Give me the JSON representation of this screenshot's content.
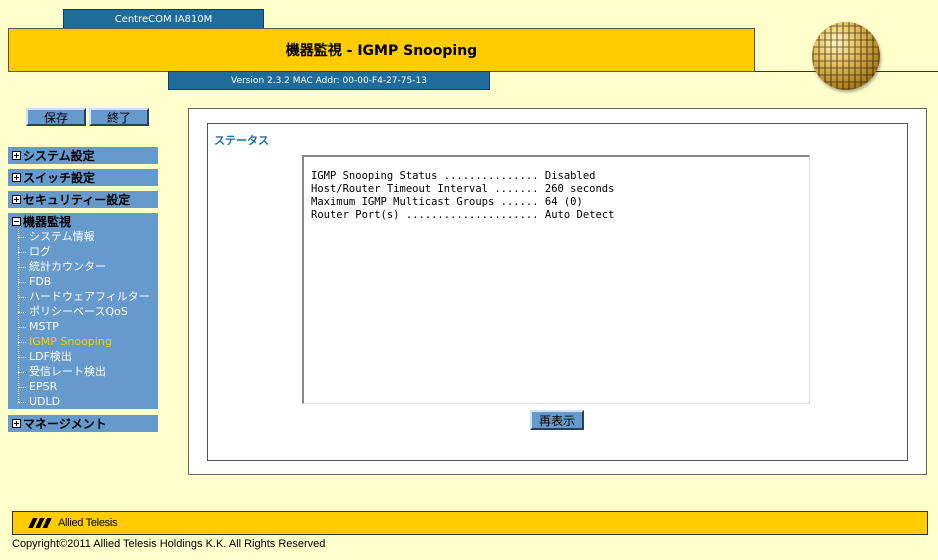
{
  "header": {
    "device_name": "CentreCOM IA810M",
    "page_title": "機器監視 - IGMP Snooping",
    "version_info": "Version 2.3.2  MAC Addr: 00-00-F4-27-75-13"
  },
  "toolbar": {
    "save_label": "保存",
    "exit_label": "終了"
  },
  "sidebar": {
    "items": [
      {
        "label": "システム設定"
      },
      {
        "label": "スイッチ設定"
      },
      {
        "label": "セキュリティー設定"
      },
      {
        "label": "機器監視"
      },
      {
        "label": "マネージメント"
      }
    ],
    "monitoring_items": [
      "システム情報",
      "ログ",
      "統計カウンター",
      "FDB",
      "ハードウェアフィルター",
      "ポリシーベースQoS",
      "MSTP",
      "IGMP Snooping",
      "LDF検出",
      "受信レート検出",
      "EPSR",
      "UDLD"
    ]
  },
  "main": {
    "section_title": "ステータス",
    "status_lines": [
      "IGMP Snooping Status ............... Disabled",
      "Host/Router Timeout Interval ....... 260 seconds",
      "Maximum IGMP Multicast Groups ...... 64 (0)",
      "Router Port(s) ..................... Auto Detect"
    ],
    "refresh_label": "再表示"
  },
  "footer": {
    "brand": "Allied Telesis",
    "copyright": "Copyright©2011 Allied Telesis Holdings K.K. All Rights Reserved"
  },
  "colors": {
    "background": "#ffffcc",
    "accent_yellow": "#ffcc00",
    "nav_blue": "#6699cc",
    "header_blue": "#1f6b9b"
  }
}
